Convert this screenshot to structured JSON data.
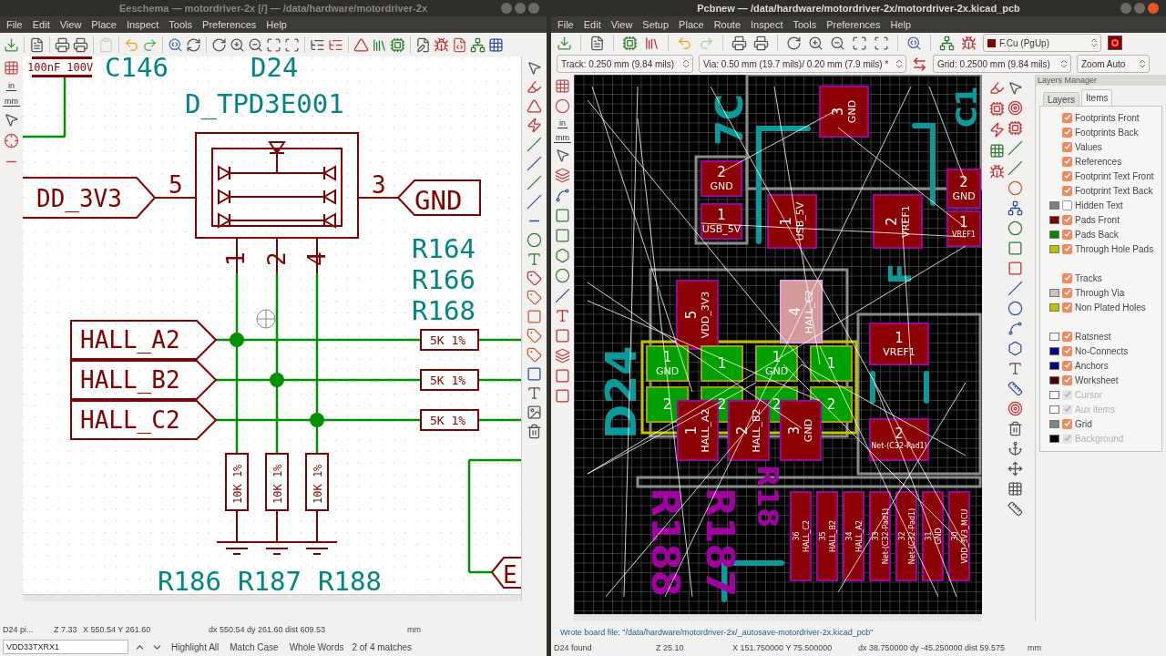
{
  "schematic_window": {
    "title": "Eeschema — motordriver-2x [/] — /data/hardware/motordriver-2x",
    "menu": [
      "File",
      "Edit",
      "View",
      "Place",
      "Inspect",
      "Tools",
      "Preferences",
      "Help"
    ],
    "unit_buttons": [
      "in",
      "mm"
    ],
    "canvas": {
      "capacitor_value": "100nF 100V",
      "capacitor_ref": "C146",
      "diode_ref": "D24",
      "diode_value": "D_TPD3E001",
      "power_label": "DD_3V3",
      "ground_label": "GND",
      "pin_numbers": [
        "5",
        "3",
        "1",
        "2",
        "4"
      ],
      "resistor_refs": [
        "R164",
        "R166",
        "R168"
      ],
      "hall_labels": [
        "HALL_A2",
        "HALL_B2",
        "HALL_C2"
      ],
      "series_values": [
        "5K 1%",
        "5K 1%",
        "5K 1%"
      ],
      "pulldown_values": [
        "10K 1%",
        "10K 1%",
        "10K 1%"
      ],
      "bottom_refs": [
        "R186",
        "R187",
        "R188"
      ],
      "offpage_label": "E"
    },
    "status_bar": [
      "D24 pi...",
      "Z 7.33",
      "X 550.54 Y 261.60",
      "dx 550.54 dy 261.60 dist 609.53",
      "mm"
    ],
    "find_bar": {
      "value": "VDD33TXRX1",
      "options": [
        "Highlight All",
        "Match Case",
        "Whole Words"
      ],
      "result": "2 of 4 matches"
    }
  },
  "pcb_window": {
    "title": "Pcbnew — /data/hardware/motordriver-2x/motordriver-2x.kicad_pcb",
    "menu": [
      "File",
      "Edit",
      "View",
      "Setup",
      "Place",
      "Route",
      "Inspect",
      "Tools",
      "Preferences",
      "Help"
    ],
    "layer_select": "F.Cu (PgUp)",
    "track": "Track: 0.250 mm (9.84 mils)",
    "via": "Via: 0.50 mm (19.7 mils)/ 0.20 mm (7.9 mils) *",
    "grid": "Grid: 0.2500 mm (9.84 mils)",
    "zoom": "Zoom Auto",
    "unit_buttons": [
      "in",
      "mm"
    ],
    "canvas": {
      "pads": [
        {
          "kind": "front",
          "number": "3",
          "net": "GND"
        },
        {
          "kind": "front",
          "number": "2",
          "net": "GND"
        },
        {
          "kind": "front",
          "number": "1",
          "net": "USB_5V"
        },
        {
          "kind": "front",
          "number": "1",
          "net": "USB_5V"
        },
        {
          "kind": "front",
          "number": "2",
          "net": "VREF1"
        },
        {
          "kind": "front",
          "number": "2",
          "net": "GND"
        },
        {
          "kind": "front",
          "number": "1",
          "net": "VREF1"
        },
        {
          "kind": "front",
          "number": "5",
          "net": "VDD_3V3"
        },
        {
          "kind": "highlighted",
          "number": "4",
          "net": "HALL_C2"
        },
        {
          "kind": "front",
          "number": "1",
          "net": "VREF1"
        },
        {
          "kind": "back",
          "number": "1",
          "net": "GND"
        },
        {
          "kind": "back",
          "number": "1"
        },
        {
          "kind": "back",
          "number": "1",
          "net": "GND"
        },
        {
          "kind": "back",
          "number": "1"
        },
        {
          "kind": "back",
          "number": "2"
        },
        {
          "kind": "back",
          "number": "2"
        },
        {
          "kind": "back",
          "number": "2"
        },
        {
          "kind": "back",
          "number": "2"
        },
        {
          "kind": "front",
          "number": "1",
          "net": "HALL_A2"
        },
        {
          "kind": "front",
          "number": "2",
          "net": "HALL_B2"
        },
        {
          "kind": "front",
          "number": "3",
          "net": "GND"
        },
        {
          "kind": "front",
          "number": "2",
          "net": "Net-(C32-Pad1)"
        },
        {
          "kind": "front",
          "number": "36",
          "net": "HALL_C2"
        },
        {
          "kind": "front",
          "number": "35",
          "net": "HALL_B2"
        },
        {
          "kind": "front",
          "number": "34",
          "net": "HALL_A2"
        },
        {
          "kind": "front",
          "number": "33",
          "net": "Net-(C32-Pad1)"
        },
        {
          "kind": "front",
          "number": "32",
          "net": "Net-(C32-Pad1)"
        },
        {
          "kind": "front",
          "number": "31",
          "net": "GND"
        },
        {
          "kind": "front",
          "number": "30",
          "net": "VDD_3V3_MCU"
        }
      ],
      "front_silk": [
        "7C",
        "C1",
        "F",
        "D24"
      ],
      "back_silk": [
        "R188",
        "R187",
        "R18"
      ]
    },
    "layers_manager": {
      "title": "Layers Manager",
      "tabs": [
        {
          "label": "Layers",
          "selected": false
        },
        {
          "label": "Items",
          "selected": true
        }
      ],
      "groups": [
        [
          {
            "label": "Footprints Front",
            "checked": true,
            "disabled": false
          },
          {
            "label": "Footprints Back",
            "checked": true,
            "disabled": false
          },
          {
            "label": "Values",
            "checked": true,
            "disabled": false
          },
          {
            "label": "References",
            "checked": true,
            "disabled": false
          },
          {
            "label": "Footprint Text Front",
            "checked": true,
            "disabled": false
          },
          {
            "label": "Footprint Text Back",
            "checked": true,
            "disabled": false
          },
          {
            "label": "Hidden Text",
            "checked": false,
            "disabled": false,
            "color": "#808080"
          },
          {
            "label": "Pads Front",
            "checked": true,
            "disabled": false,
            "color": "#840000"
          },
          {
            "label": "Pads Back",
            "checked": true,
            "disabled": false,
            "color": "#008400"
          },
          {
            "label": "Through Hole Pads",
            "checked": true,
            "disabled": false,
            "color": "#c2c200"
          }
        ],
        [
          {
            "label": "Tracks",
            "checked": true,
            "disabled": false
          },
          {
            "label": "Through Via",
            "checked": true,
            "disabled": false,
            "color": "#c2c2c2"
          },
          {
            "label": "Non Plated Holes",
            "checked": true,
            "disabled": false,
            "color": "#c2c200"
          }
        ],
        [
          {
            "label": "Ratsnest",
            "checked": true,
            "disabled": false,
            "color": "#ffffff"
          },
          {
            "label": "No-Connects",
            "checked": true,
            "disabled": false,
            "color": "#000084"
          },
          {
            "label": "Anchors",
            "checked": true,
            "disabled": false,
            "color": "#000084"
          },
          {
            "label": "Worksheet",
            "checked": true,
            "disabled": false,
            "color": "#480000"
          },
          {
            "label": "Cursor",
            "checked": true,
            "disabled": true,
            "color": "#ffffff"
          },
          {
            "label": "Aux items",
            "checked": true,
            "disabled": true,
            "color": "#ffffff"
          },
          {
            "label": "Grid",
            "checked": true,
            "disabled": false,
            "color": "#848484"
          },
          {
            "label": "Background",
            "checked": true,
            "disabled": true,
            "color": "#000000"
          }
        ]
      ]
    },
    "message": "Wrote board file: \"/data/hardware/motordriver-2x/_autosave-motordriver-2x.kicad_pcb\"",
    "status_bar": [
      "D24 found",
      "Z 25.10",
      "X 151.750000 Y 75.500000",
      "dx 38.750000 dy -45.250000 dist 59.575",
      "mm"
    ]
  }
}
